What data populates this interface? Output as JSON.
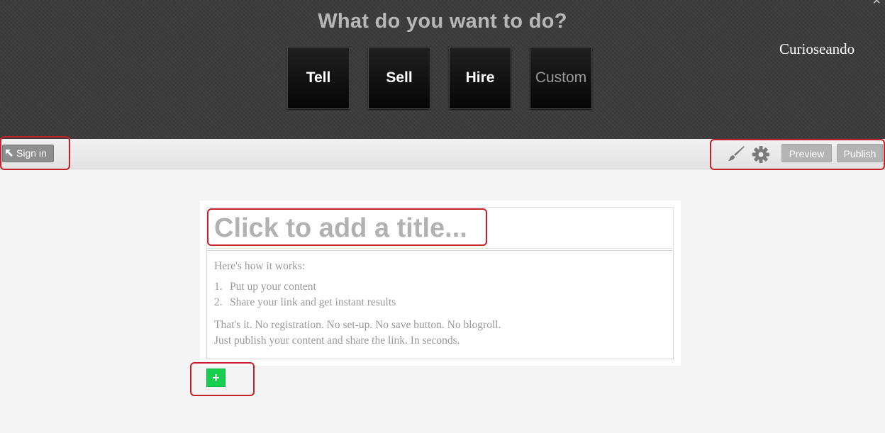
{
  "header": {
    "title": "What do you want to do?",
    "brand": "Curioseando",
    "close_glyph": "×",
    "modes": [
      {
        "label": "Tell"
      },
      {
        "label": "Sell"
      },
      {
        "label": "Hire"
      },
      {
        "label": "Custom"
      }
    ]
  },
  "toolbar": {
    "sign_in_label": "Sign in",
    "preview_label": "Preview",
    "publish_label": "Publish",
    "icons": [
      "arrow-up-left-icon",
      "brush-icon",
      "gear-icon"
    ]
  },
  "editor": {
    "title_placeholder": "Click to add a title...",
    "intro": "Here's how it works:",
    "steps": [
      {
        "num": "1.",
        "text": "Put up your content"
      },
      {
        "num": "2.",
        "text": "Share your link and get instant results"
      }
    ],
    "outro_line1": "That's it. No registration. No set-up. No save button. No blogroll.",
    "outro_line2": "Just publish your content and share the link. In seconds."
  },
  "add_block": {
    "label": "+"
  },
  "colors": {
    "header_bg": "#3a3a3a",
    "annotation": "#c8202a",
    "add_button": "#17cf4f"
  }
}
